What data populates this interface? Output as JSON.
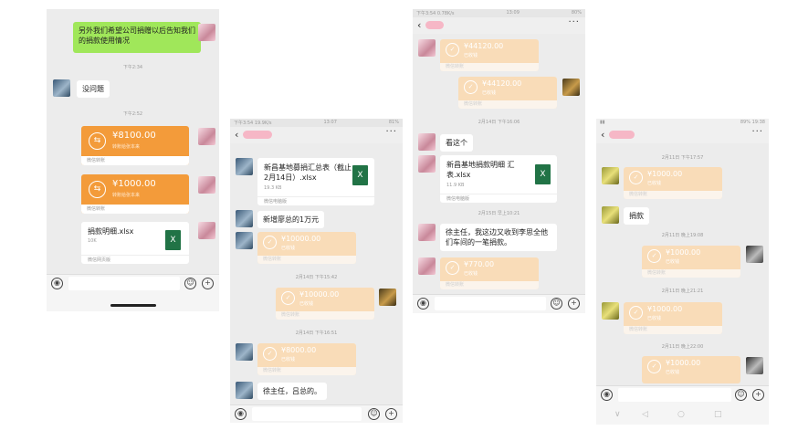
{
  "phone1": {
    "bubble_top": "另外我们希望公司捐赠以后告知我们的捐款使用情况",
    "time_1": "下午2:34",
    "reply": "没问题",
    "time_2": "下午2:52",
    "transfer_1": {
      "amount": "¥8100.00",
      "sub": "转账给张本来",
      "footer": "微信转账"
    },
    "transfer_2": {
      "amount": "¥1000.00",
      "sub": "转账给张本来",
      "footer": "微信转账"
    },
    "file": {
      "name": "捐款明细.xlsx",
      "size": "10K",
      "footer": "微信网页版"
    }
  },
  "phone2": {
    "status_left": "下午3:54 19.9K/s",
    "status_center": "13:07",
    "status_right": "81%",
    "file": {
      "name": "新昌基地募捐汇总表（截止2月14日）.xlsx",
      "size": "19.3 KB",
      "footer": "微信电脑版"
    },
    "msg_1": "新增廖总的1万元",
    "transfer_1": {
      "amount": "¥10000.00",
      "sub": "已收钱",
      "footer": "微信转账"
    },
    "time_1": "2月14日 下午15:42",
    "transfer_2": {
      "amount": "¥10000.00",
      "sub": "已收钱",
      "footer": "微信转账"
    },
    "time_2": "2月14日 下午16:51",
    "transfer_3": {
      "amount": "¥8000.00",
      "sub": "已收钱",
      "footer": "微信转账"
    },
    "msg_2": "徐主任，吕总的。"
  },
  "phone3": {
    "status_left": "下午3:54 0.78K/s",
    "status_center": "13:09",
    "status_right": "80%",
    "transfer_1": {
      "amount": "¥44120.00",
      "sub": "已收钱",
      "footer": "微信转账"
    },
    "transfer_2": {
      "amount": "¥44120.00",
      "sub": "已收钱",
      "footer": "微信转账"
    },
    "time_1": "2月14日 下午16:06",
    "msg_1": "看这个",
    "file": {
      "name": "新昌基地捐款明细 汇表.xlsx",
      "size": "11.9 KB",
      "footer": "微信电脑版"
    },
    "time_2": "2月15日 早上10:21",
    "msg_2": "徐主任，我这边又收到李思全他们车间的一笔捐款。",
    "transfer_3": {
      "amount": "¥770.00",
      "sub": "已收钱",
      "footer": "微信转账"
    }
  },
  "phone4": {
    "status_right": "89% 19:38",
    "time_1": "2月11日 下午17:57",
    "transfer_1": {
      "amount": "¥1000.00",
      "sub": "已收钱",
      "footer": "微信转账"
    },
    "msg_1": "捐款",
    "time_2": "2月11日 晚上19:08",
    "transfer_2": {
      "amount": "¥1000.00",
      "sub": "已收钱",
      "footer": "微信转账"
    },
    "time_3": "2月11日 晚上21:21",
    "transfer_3": {
      "amount": "¥1000.00",
      "sub": "已收钱",
      "footer": "微信转账"
    },
    "time_4": "2月11日 晚上22:00",
    "transfer_4": {
      "amount": "¥1000.00",
      "sub": "已收钱",
      "footer": "微信转账"
    }
  },
  "icons": {
    "voice": "voice-icon",
    "emoji": "emoji-icon",
    "plus": "plus-icon",
    "transfer": "transfer-icon",
    "check": "check-icon",
    "excel": "excel-icon"
  },
  "colors": {
    "transfer_orange": "#f39b3a",
    "transfer_faded": "#f9dcb8",
    "sent_green": "#a0e75a",
    "excel_green": "#217346"
  }
}
